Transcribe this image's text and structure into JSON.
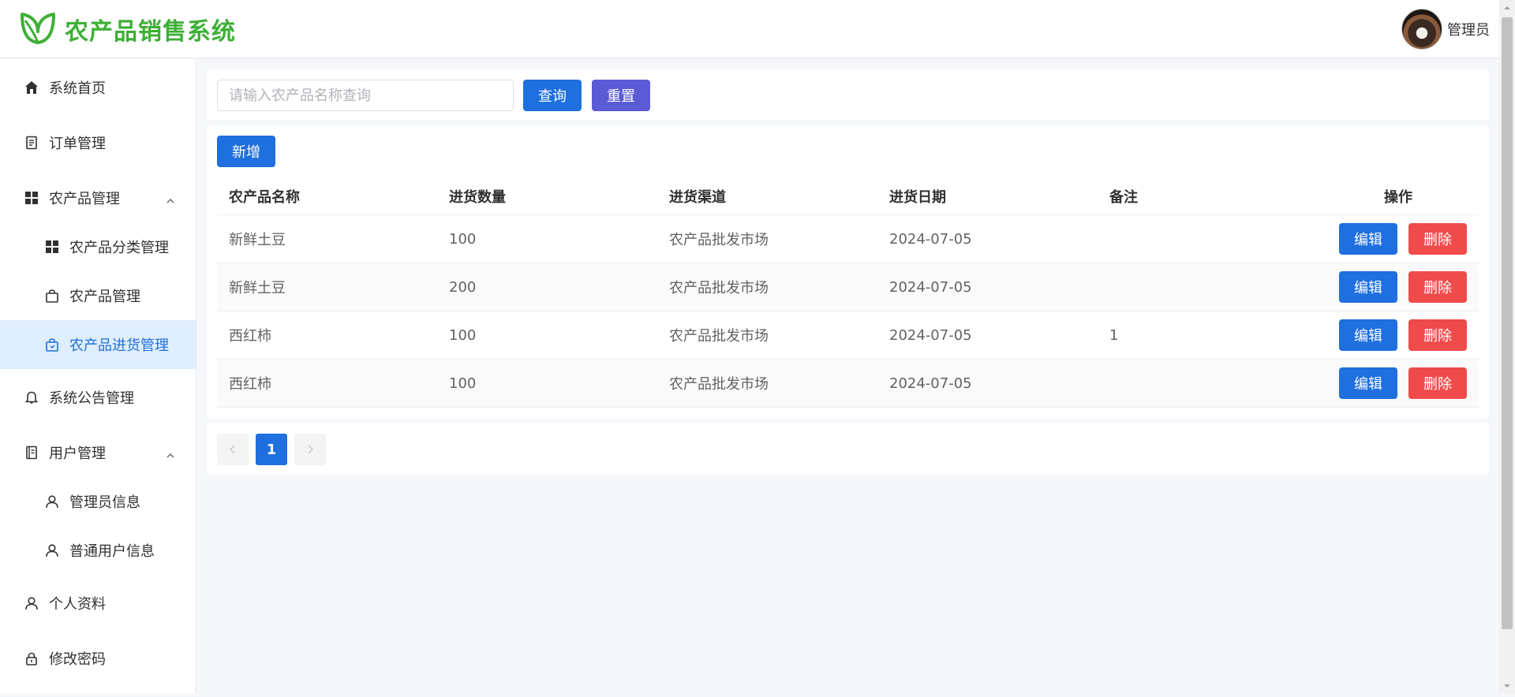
{
  "header": {
    "app_title": "农产品销售系统",
    "user_name": "管理员",
    "brand_color": "#3cb035"
  },
  "sidebar": {
    "items": [
      {
        "label": "系统首页",
        "icon": "home-icon"
      },
      {
        "label": "订单管理",
        "icon": "document-icon"
      },
      {
        "label": "农产品管理",
        "icon": "grid-icon",
        "expanded": true
      },
      {
        "label": "农产品分类管理",
        "icon": "grid-icon"
      },
      {
        "label": "农产品管理",
        "icon": "shopping-bag-icon"
      },
      {
        "label": "农产品进货管理",
        "icon": "shopping-bag-icon",
        "active": true
      },
      {
        "label": "系统公告管理",
        "icon": "bell-icon"
      },
      {
        "label": "用户管理",
        "icon": "notebook-icon",
        "expanded": true
      },
      {
        "label": "管理员信息",
        "icon": "user-icon"
      },
      {
        "label": "普通用户信息",
        "icon": "user-icon"
      },
      {
        "label": "个人资料",
        "icon": "user-icon"
      },
      {
        "label": "修改密码",
        "icon": "lock-icon"
      }
    ]
  },
  "search": {
    "placeholder": "请输入农产品名称查询",
    "value": "",
    "query_label": "查询",
    "reset_label": "重置"
  },
  "toolbar": {
    "add_label": "新增"
  },
  "table": {
    "columns": [
      "农产品名称",
      "进货数量",
      "进货渠道",
      "进货日期",
      "备注",
      "操作"
    ],
    "rows": [
      {
        "name": "新鲜土豆",
        "quantity": "100",
        "channel": "农产品批发市场",
        "date": "2024-07-05",
        "remark": ""
      },
      {
        "name": "新鲜土豆",
        "quantity": "200",
        "channel": "农产品批发市场",
        "date": "2024-07-05",
        "remark": ""
      },
      {
        "name": "西红柿",
        "quantity": "100",
        "channel": "农产品批发市场",
        "date": "2024-07-05",
        "remark": "1"
      },
      {
        "name": "西红柿",
        "quantity": "100",
        "channel": "农产品批发市场",
        "date": "2024-07-05",
        "remark": ""
      }
    ],
    "edit_label": "编辑",
    "delete_label": "删除"
  },
  "pagination": {
    "current_page": "1"
  },
  "colors": {
    "primary": "#1f6fde",
    "reset": "#5b5bd6",
    "danger": "#f04b4b",
    "active_menu_bg": "#dfeefe"
  }
}
